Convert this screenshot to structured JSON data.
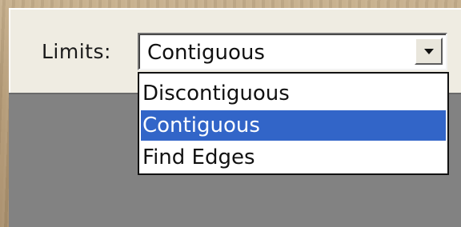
{
  "limits": {
    "label": "Limits:",
    "selected_value": "Contiguous",
    "dropdown_arrow_icon": "triangle-down-icon",
    "options": [
      {
        "label": "Discontiguous",
        "selected": false
      },
      {
        "label": "Contiguous",
        "selected": true
      },
      {
        "label": "Find Edges",
        "selected": false
      }
    ]
  },
  "colors": {
    "highlight": "#3265c8",
    "panel": "#efece2",
    "canvas_gray": "#828282"
  }
}
